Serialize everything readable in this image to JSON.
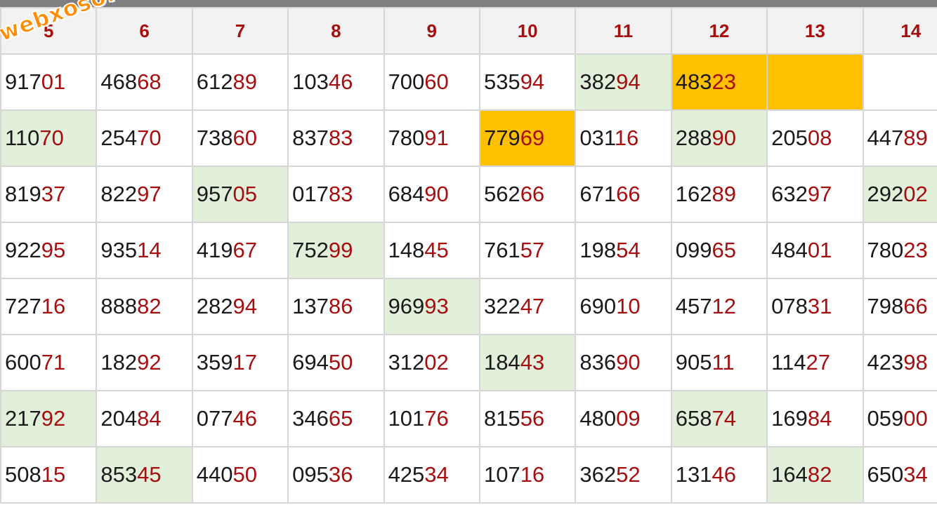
{
  "watermark": "webxoso.net",
  "columns": [
    "5",
    "6",
    "7",
    "8",
    "9",
    "10",
    "11",
    "12",
    "13",
    "14"
  ],
  "rows": [
    [
      {
        "v": "91701"
      },
      {
        "v": "46868"
      },
      {
        "v": "61289"
      },
      {
        "v": "10346"
      },
      {
        "v": "70060"
      },
      {
        "v": "53594"
      },
      {
        "v": "38294",
        "hl": "green"
      },
      {
        "v": "48323",
        "hl": "orange"
      },
      {
        "v": "",
        "hl": "orange"
      },
      {
        "v": ""
      }
    ],
    [
      {
        "v": "11070",
        "hl": "green"
      },
      {
        "v": "25470"
      },
      {
        "v": "73860"
      },
      {
        "v": "83783"
      },
      {
        "v": "78091"
      },
      {
        "v": "77969",
        "hl": "orange"
      },
      {
        "v": "03116"
      },
      {
        "v": "28890",
        "hl": "green"
      },
      {
        "v": "20508"
      },
      {
        "v": "44789"
      }
    ],
    [
      {
        "v": "81937"
      },
      {
        "v": "82297"
      },
      {
        "v": "95705",
        "hl": "green"
      },
      {
        "v": "01783"
      },
      {
        "v": "68490"
      },
      {
        "v": "56266"
      },
      {
        "v": "67166"
      },
      {
        "v": "16289"
      },
      {
        "v": "63297"
      },
      {
        "v": "29202",
        "hl": "green"
      }
    ],
    [
      {
        "v": "92295"
      },
      {
        "v": "93514"
      },
      {
        "v": "41967"
      },
      {
        "v": "75299",
        "hl": "green"
      },
      {
        "v": "14845"
      },
      {
        "v": "76157"
      },
      {
        "v": "19854"
      },
      {
        "v": "09965"
      },
      {
        "v": "48401"
      },
      {
        "v": "78023"
      }
    ],
    [
      {
        "v": "72716"
      },
      {
        "v": "88882"
      },
      {
        "v": "28294"
      },
      {
        "v": "13786"
      },
      {
        "v": "96993",
        "hl": "green"
      },
      {
        "v": "32247"
      },
      {
        "v": "69010"
      },
      {
        "v": "45712"
      },
      {
        "v": "07831"
      },
      {
        "v": "79866"
      }
    ],
    [
      {
        "v": "60071"
      },
      {
        "v": "18292"
      },
      {
        "v": "35917"
      },
      {
        "v": "69450"
      },
      {
        "v": "31202"
      },
      {
        "v": "18443",
        "hl": "green"
      },
      {
        "v": "83690"
      },
      {
        "v": "90511"
      },
      {
        "v": "11427"
      },
      {
        "v": "42398"
      }
    ],
    [
      {
        "v": "21792",
        "hl": "green"
      },
      {
        "v": "20484"
      },
      {
        "v": "07746"
      },
      {
        "v": "34665"
      },
      {
        "v": "10176"
      },
      {
        "v": "81556"
      },
      {
        "v": "48009"
      },
      {
        "v": "65874",
        "hl": "green"
      },
      {
        "v": "16984"
      },
      {
        "v": "05900"
      }
    ],
    [
      {
        "v": "50815"
      },
      {
        "v": "85345",
        "hl": "green"
      },
      {
        "v": "44050"
      },
      {
        "v": "09536"
      },
      {
        "v": "42534"
      },
      {
        "v": "10716"
      },
      {
        "v": "36252"
      },
      {
        "v": "13146"
      },
      {
        "v": "16482",
        "hl": "green"
      },
      {
        "v": "65034"
      }
    ]
  ]
}
